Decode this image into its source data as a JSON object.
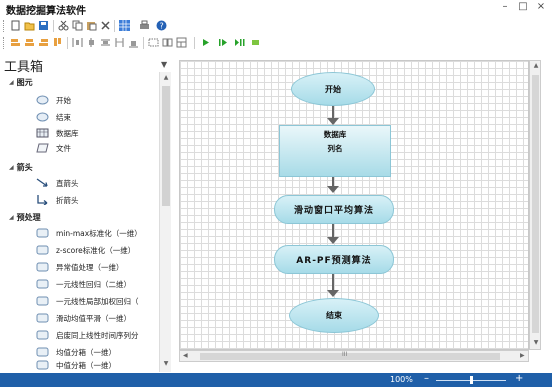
{
  "app": {
    "title": "数据挖掘算法软件",
    "minimize": "–",
    "maximize": "□",
    "close": "×"
  },
  "toolbar1": [
    "new-file-icon",
    "open-folder-icon",
    "save-icon",
    "cut-icon",
    "copy-icon",
    "paste-icon",
    "delete-icon",
    "grid-icon",
    "print-icon",
    "help-icon"
  ],
  "toolbar2": [
    "align-left-icon",
    "align-center-icon",
    "align-right-icon",
    "align-top-icon",
    "distribute-h-icon",
    "distribute-v-icon",
    "same-width-icon",
    "same-height-icon",
    "same-size-icon",
    "group-icon",
    "ungroup-icon",
    "layout-icon",
    "run-icon",
    "step-icon",
    "pause-icon",
    "stop-icon"
  ],
  "toolbox": {
    "title": "工具箱",
    "groups": [
      {
        "label": "图元",
        "items": [
          {
            "label": "开始",
            "icon": "ellipse-icon"
          },
          {
            "label": "结束",
            "icon": "ellipse-icon"
          },
          {
            "label": "数据库",
            "icon": "database-icon"
          },
          {
            "label": "文件",
            "icon": "file-icon"
          }
        ]
      },
      {
        "label": "箭头",
        "items": [
          {
            "label": "直箭头",
            "icon": "straight-arrow-icon"
          },
          {
            "label": "折箭头",
            "icon": "elbow-arrow-icon"
          }
        ]
      },
      {
        "label": "预处理",
        "items": [
          {
            "label": "min-max标准化（一维）",
            "icon": "process-icon"
          },
          {
            "label": "z-score标准化（一维）",
            "icon": "process-icon"
          },
          {
            "label": "异常值处理（一维）",
            "icon": "process-icon"
          },
          {
            "label": "一元线性回归（二维）",
            "icon": "process-icon"
          },
          {
            "label": "一元线性局部加权回归（",
            "icon": "process-icon"
          },
          {
            "label": "滑动均值平滑（一维）",
            "icon": "process-icon"
          },
          {
            "label": "启废同上线性时间序列分",
            "icon": "process-icon"
          },
          {
            "label": "均值分箱（一维）",
            "icon": "process-icon"
          },
          {
            "label": "中值分箱（一维）",
            "icon": "process-icon"
          }
        ]
      }
    ]
  },
  "flow": {
    "start": "开始",
    "database_title": "数据库",
    "database_sub": "列名",
    "step1": "滑动窗口平均算法",
    "step2": "AR-PF预测算法",
    "end": "结束"
  },
  "canvas": {
    "hscroll_mark": "III"
  },
  "status": {
    "zoom": "100%",
    "minus": "–",
    "plus": "+"
  },
  "colors": {
    "node_fill": "#a6dbe8",
    "statusbar": "#1f5fa8"
  }
}
